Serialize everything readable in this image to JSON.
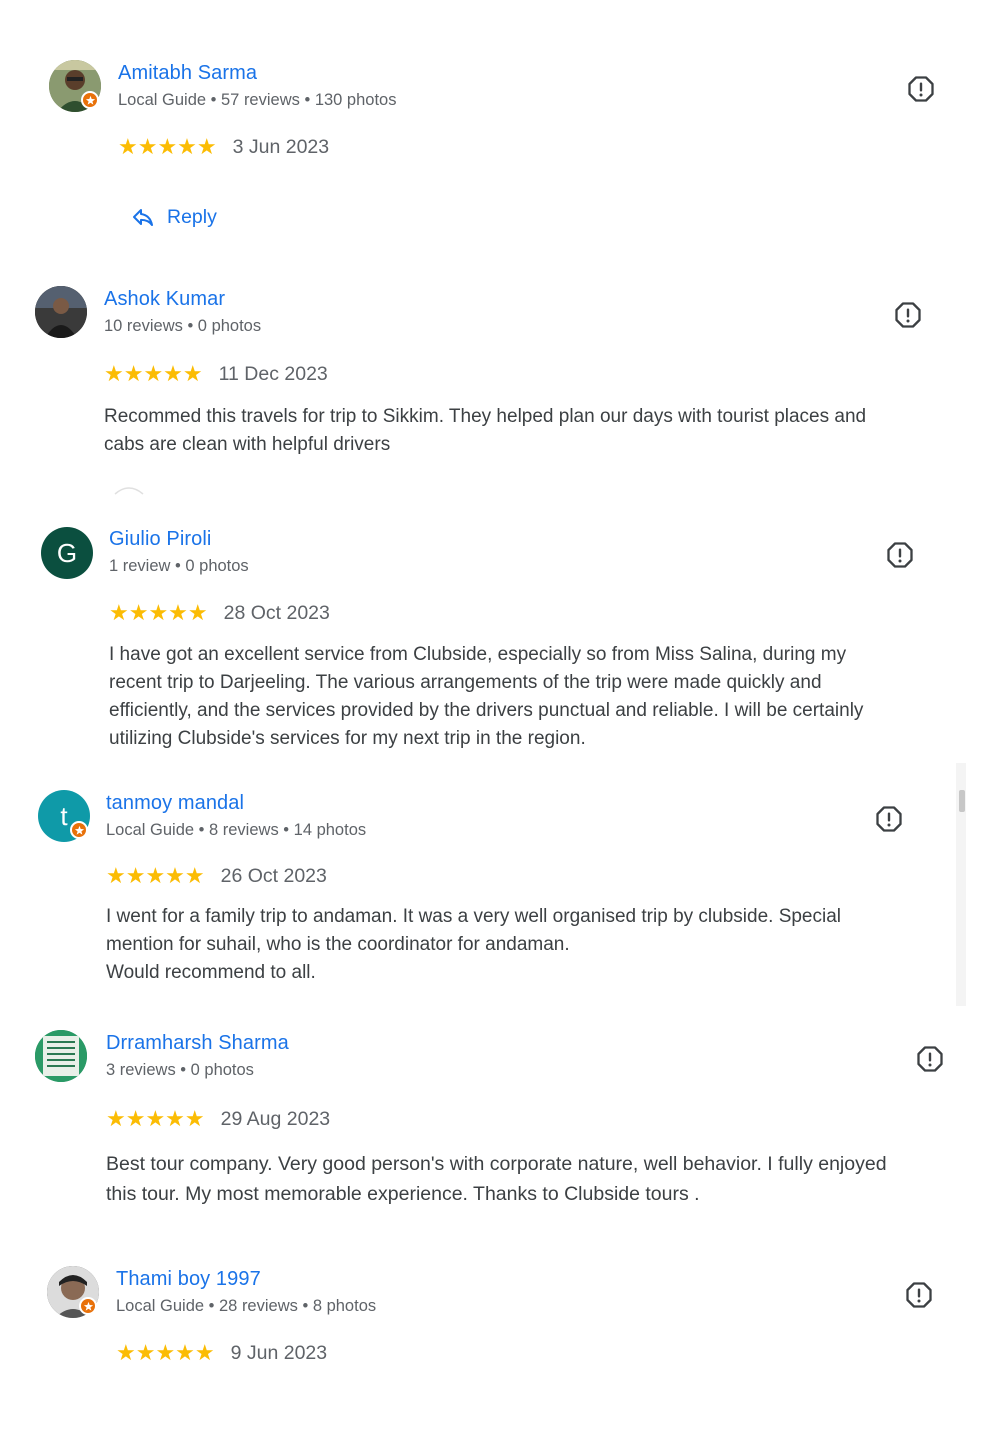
{
  "reviews": [
    {
      "name": "Amitabh Sarma",
      "meta": "Local Guide • 57 reviews • 130 photos",
      "stars": "★★★★★",
      "rating": 5,
      "date": "3 Jun 2023",
      "text": "",
      "reply_label": "Reply"
    },
    {
      "name": "Ashok Kumar",
      "meta": "10 reviews • 0 photos",
      "stars": "★★★★★",
      "rating": 5,
      "date": "11 Dec 2023",
      "text": "Recommed this travels for trip to Sikkim. They helped plan our days with tourist places and\ncabs are clean with helpful drivers"
    },
    {
      "name": "Giulio Piroli",
      "avatar_letter": "G",
      "avatar_color": "#0b4f3f",
      "meta": "1 review • 0 photos",
      "stars": "★★★★★",
      "rating": 5,
      "date": "28 Oct 2023",
      "text": "I have got an excellent service from Clubside, especially so from Miss Salina, during my\nrecent trip to Darjeeling. The various arrangements of the trip were made quickly and\nefficiently, and the services provided by the drivers punctual and reliable. I will be certainly\nutilizing Clubside's services for my next trip in the region."
    },
    {
      "name": "tanmoy mandal",
      "avatar_letter": "t",
      "avatar_color": "#0f9aa8",
      "meta": "Local Guide • 8 reviews • 14 photos",
      "stars": "★★★★★",
      "rating": 5,
      "date": "26 Oct 2023",
      "text": "I went for a family trip to andaman. It was a very well organised trip by clubside. Special\nmention for suhail, who is the coordinator for andaman.\nWould recommend to all."
    },
    {
      "name": "Drramharsh Sharma",
      "meta": "3 reviews • 0 photos",
      "stars": "★★★★★",
      "rating": 5,
      "date": "29 Aug 2023",
      "text": "Best tour company. Very good person's with corporate nature, well behavior. I fully enjoyed\nthis tour. My most memorable experience. Thanks to Clubside tours ."
    },
    {
      "name": "Thami boy 1997",
      "meta": "Local Guide • 28 reviews • 8 photos",
      "stars": "★★★★★",
      "rating": 5,
      "date": "9 Jun 2023",
      "text": ""
    }
  ],
  "colors": {
    "name_link": "#1a73e8",
    "star": "#fbbc04",
    "guide_badge": "#e8710a"
  },
  "icons": {
    "flag": "report-flag-icon",
    "reply": "reply-arrow-icon",
    "guide": "local-guide-badge-icon"
  }
}
